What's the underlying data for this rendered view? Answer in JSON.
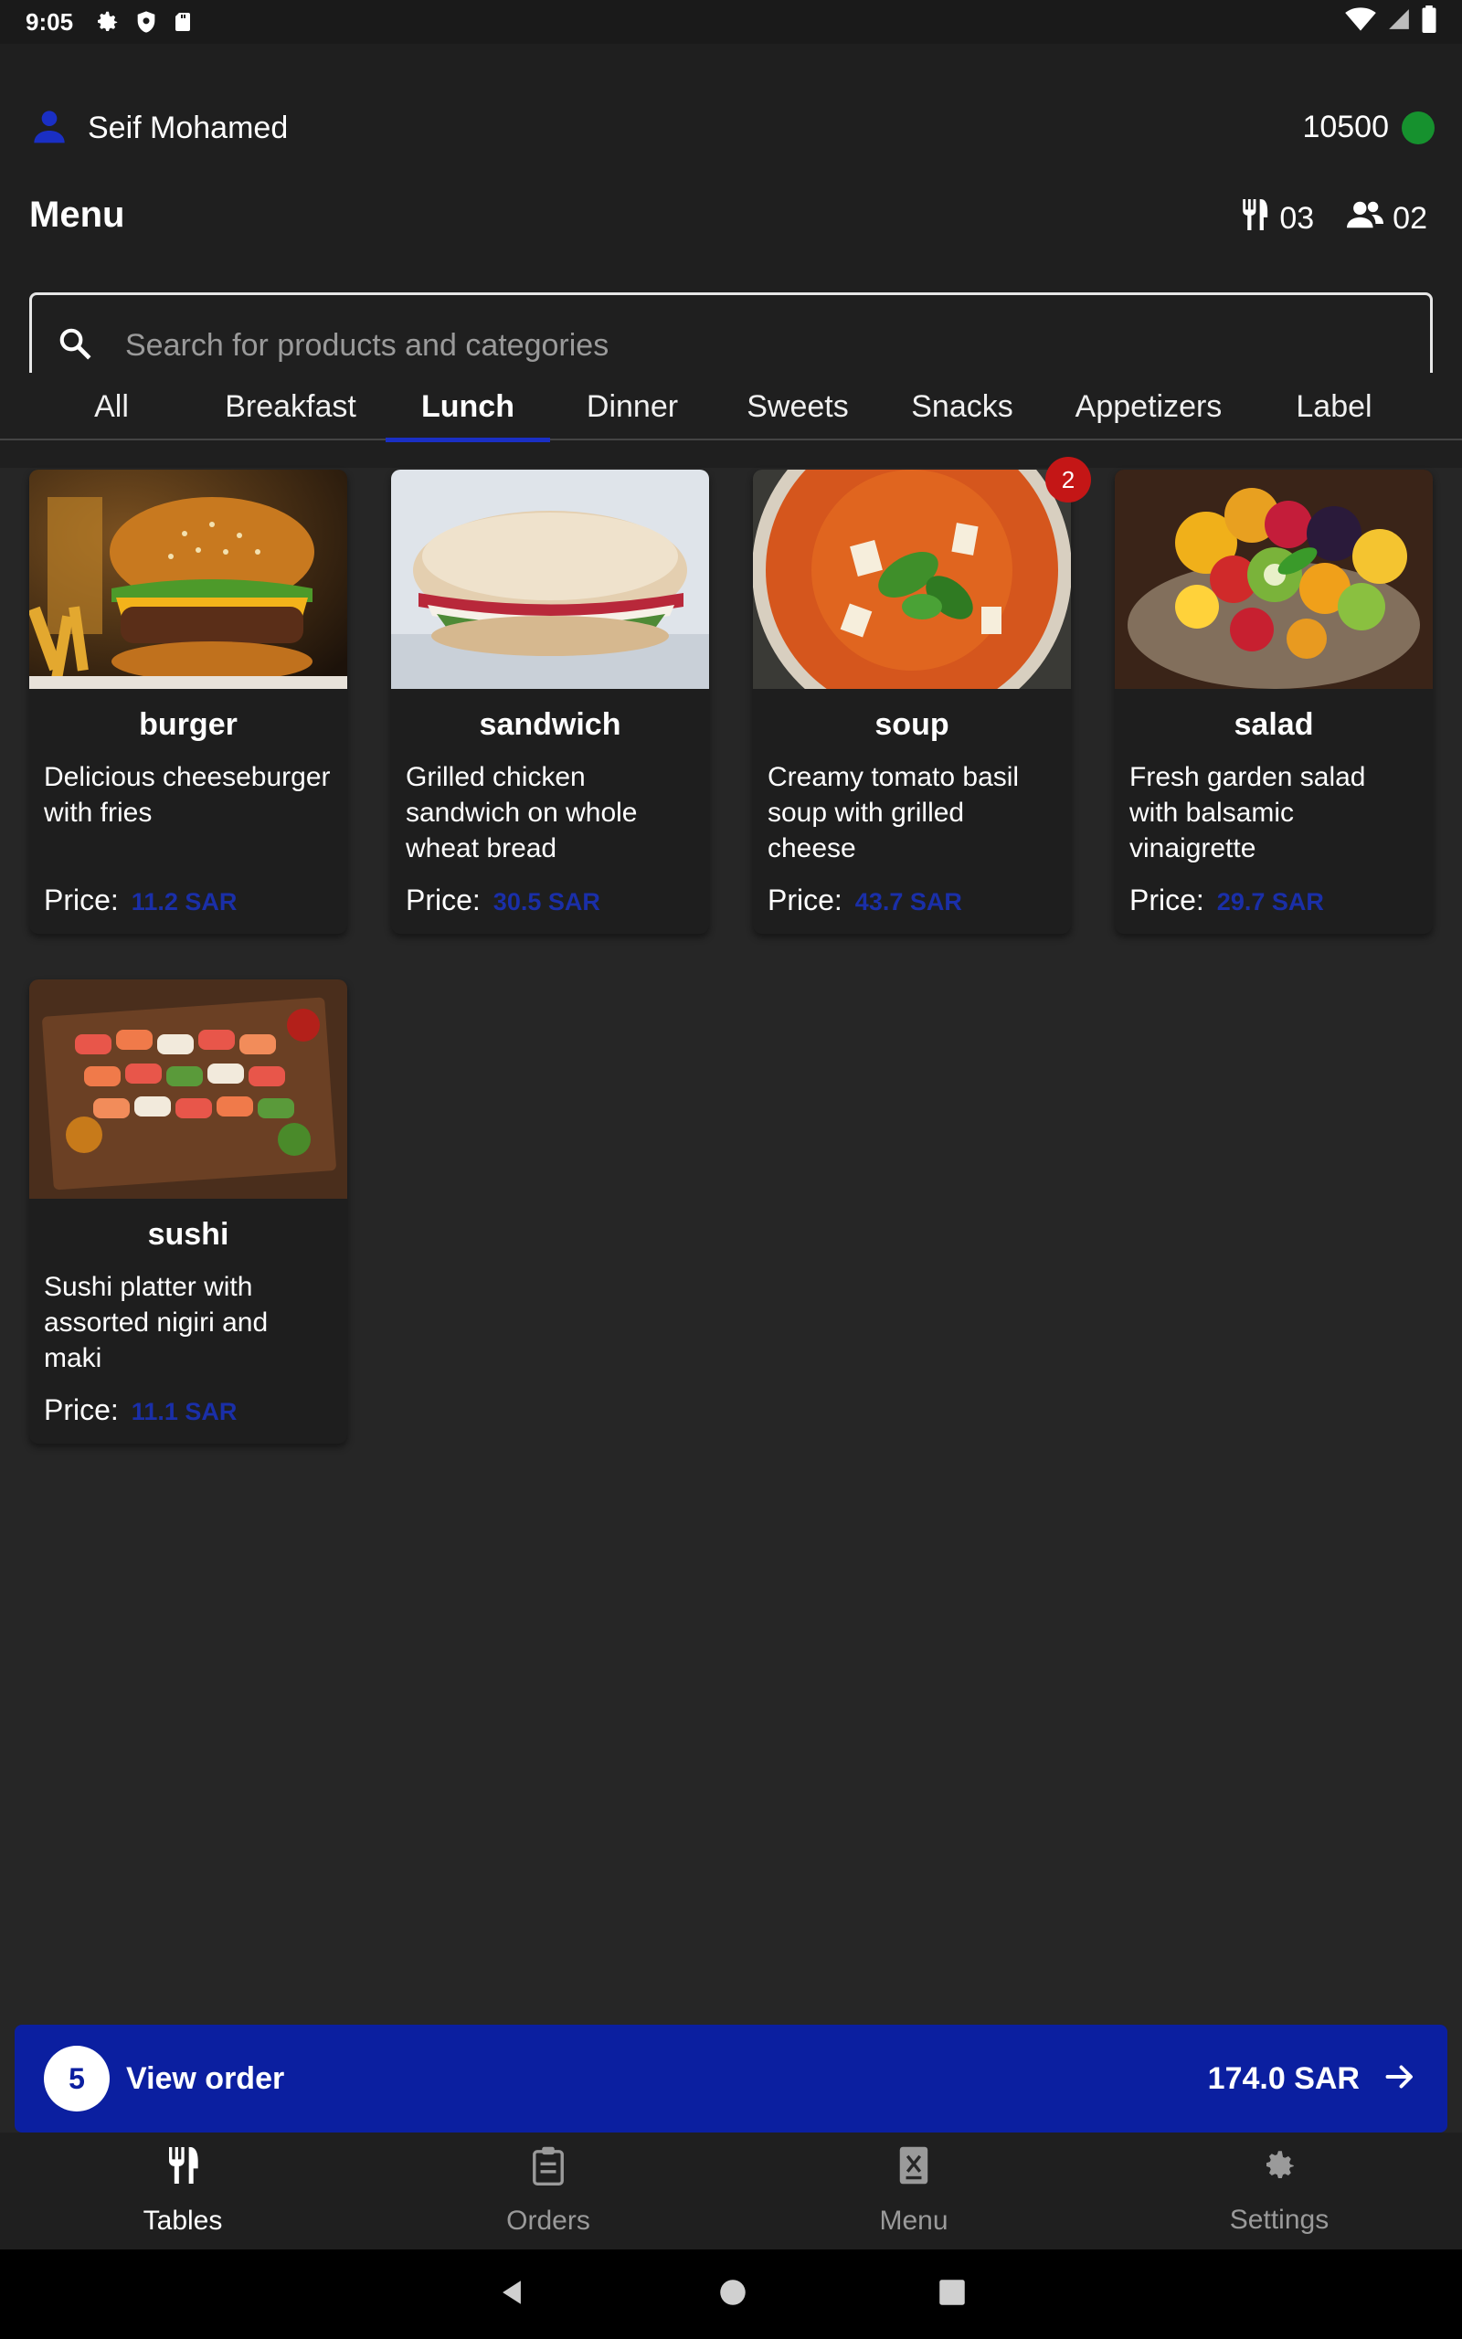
{
  "status_bar": {
    "time": "9:05"
  },
  "header": {
    "user_name": "Seif Mohamed",
    "points": "10500",
    "title": "Menu",
    "tables_count": "03",
    "guests_count": "02"
  },
  "search": {
    "placeholder": "Search for products and categories",
    "value": ""
  },
  "tabs": [
    {
      "label": "All"
    },
    {
      "label": "Breakfast"
    },
    {
      "label": "Lunch",
      "active": true
    },
    {
      "label": "Dinner"
    },
    {
      "label": "Sweets"
    },
    {
      "label": "Snacks"
    },
    {
      "label": "Appetizers"
    },
    {
      "label": "Label"
    }
  ],
  "products": [
    {
      "name": "burger",
      "description": "Delicious cheeseburger with fries",
      "price_label": "Price:",
      "price": "11.2 SAR"
    },
    {
      "name": "sandwich",
      "description": "Grilled chicken sandwich on whole wheat bread",
      "price_label": "Price:",
      "price": "30.5 SAR"
    },
    {
      "name": "soup",
      "description": "Creamy tomato basil soup with grilled cheese",
      "price_label": "Price:",
      "price": "43.7 SAR",
      "badge": "2"
    },
    {
      "name": "salad",
      "description": "Fresh garden salad with balsamic vinaigrette",
      "price_label": "Price:",
      "price": "29.7 SAR"
    },
    {
      "name": "sushi",
      "description": "Sushi platter with assorted nigiri and maki",
      "price_label": "Price:",
      "price": "11.1 SAR"
    }
  ],
  "order_bar": {
    "count": "5",
    "label": "View order",
    "total": "174.0 SAR"
  },
  "bottom_nav": [
    {
      "label": "Tables",
      "icon": "fork-knife-icon",
      "active": true
    },
    {
      "label": "Orders",
      "icon": "clipboard-icon"
    },
    {
      "label": "Menu",
      "icon": "menu-book-icon"
    },
    {
      "label": "Settings",
      "icon": "gear-icon"
    }
  ],
  "colors": {
    "accent": "#0b1fa0",
    "online": "#16912e",
    "badge": "#c41616",
    "price": "#1a2fa8"
  }
}
